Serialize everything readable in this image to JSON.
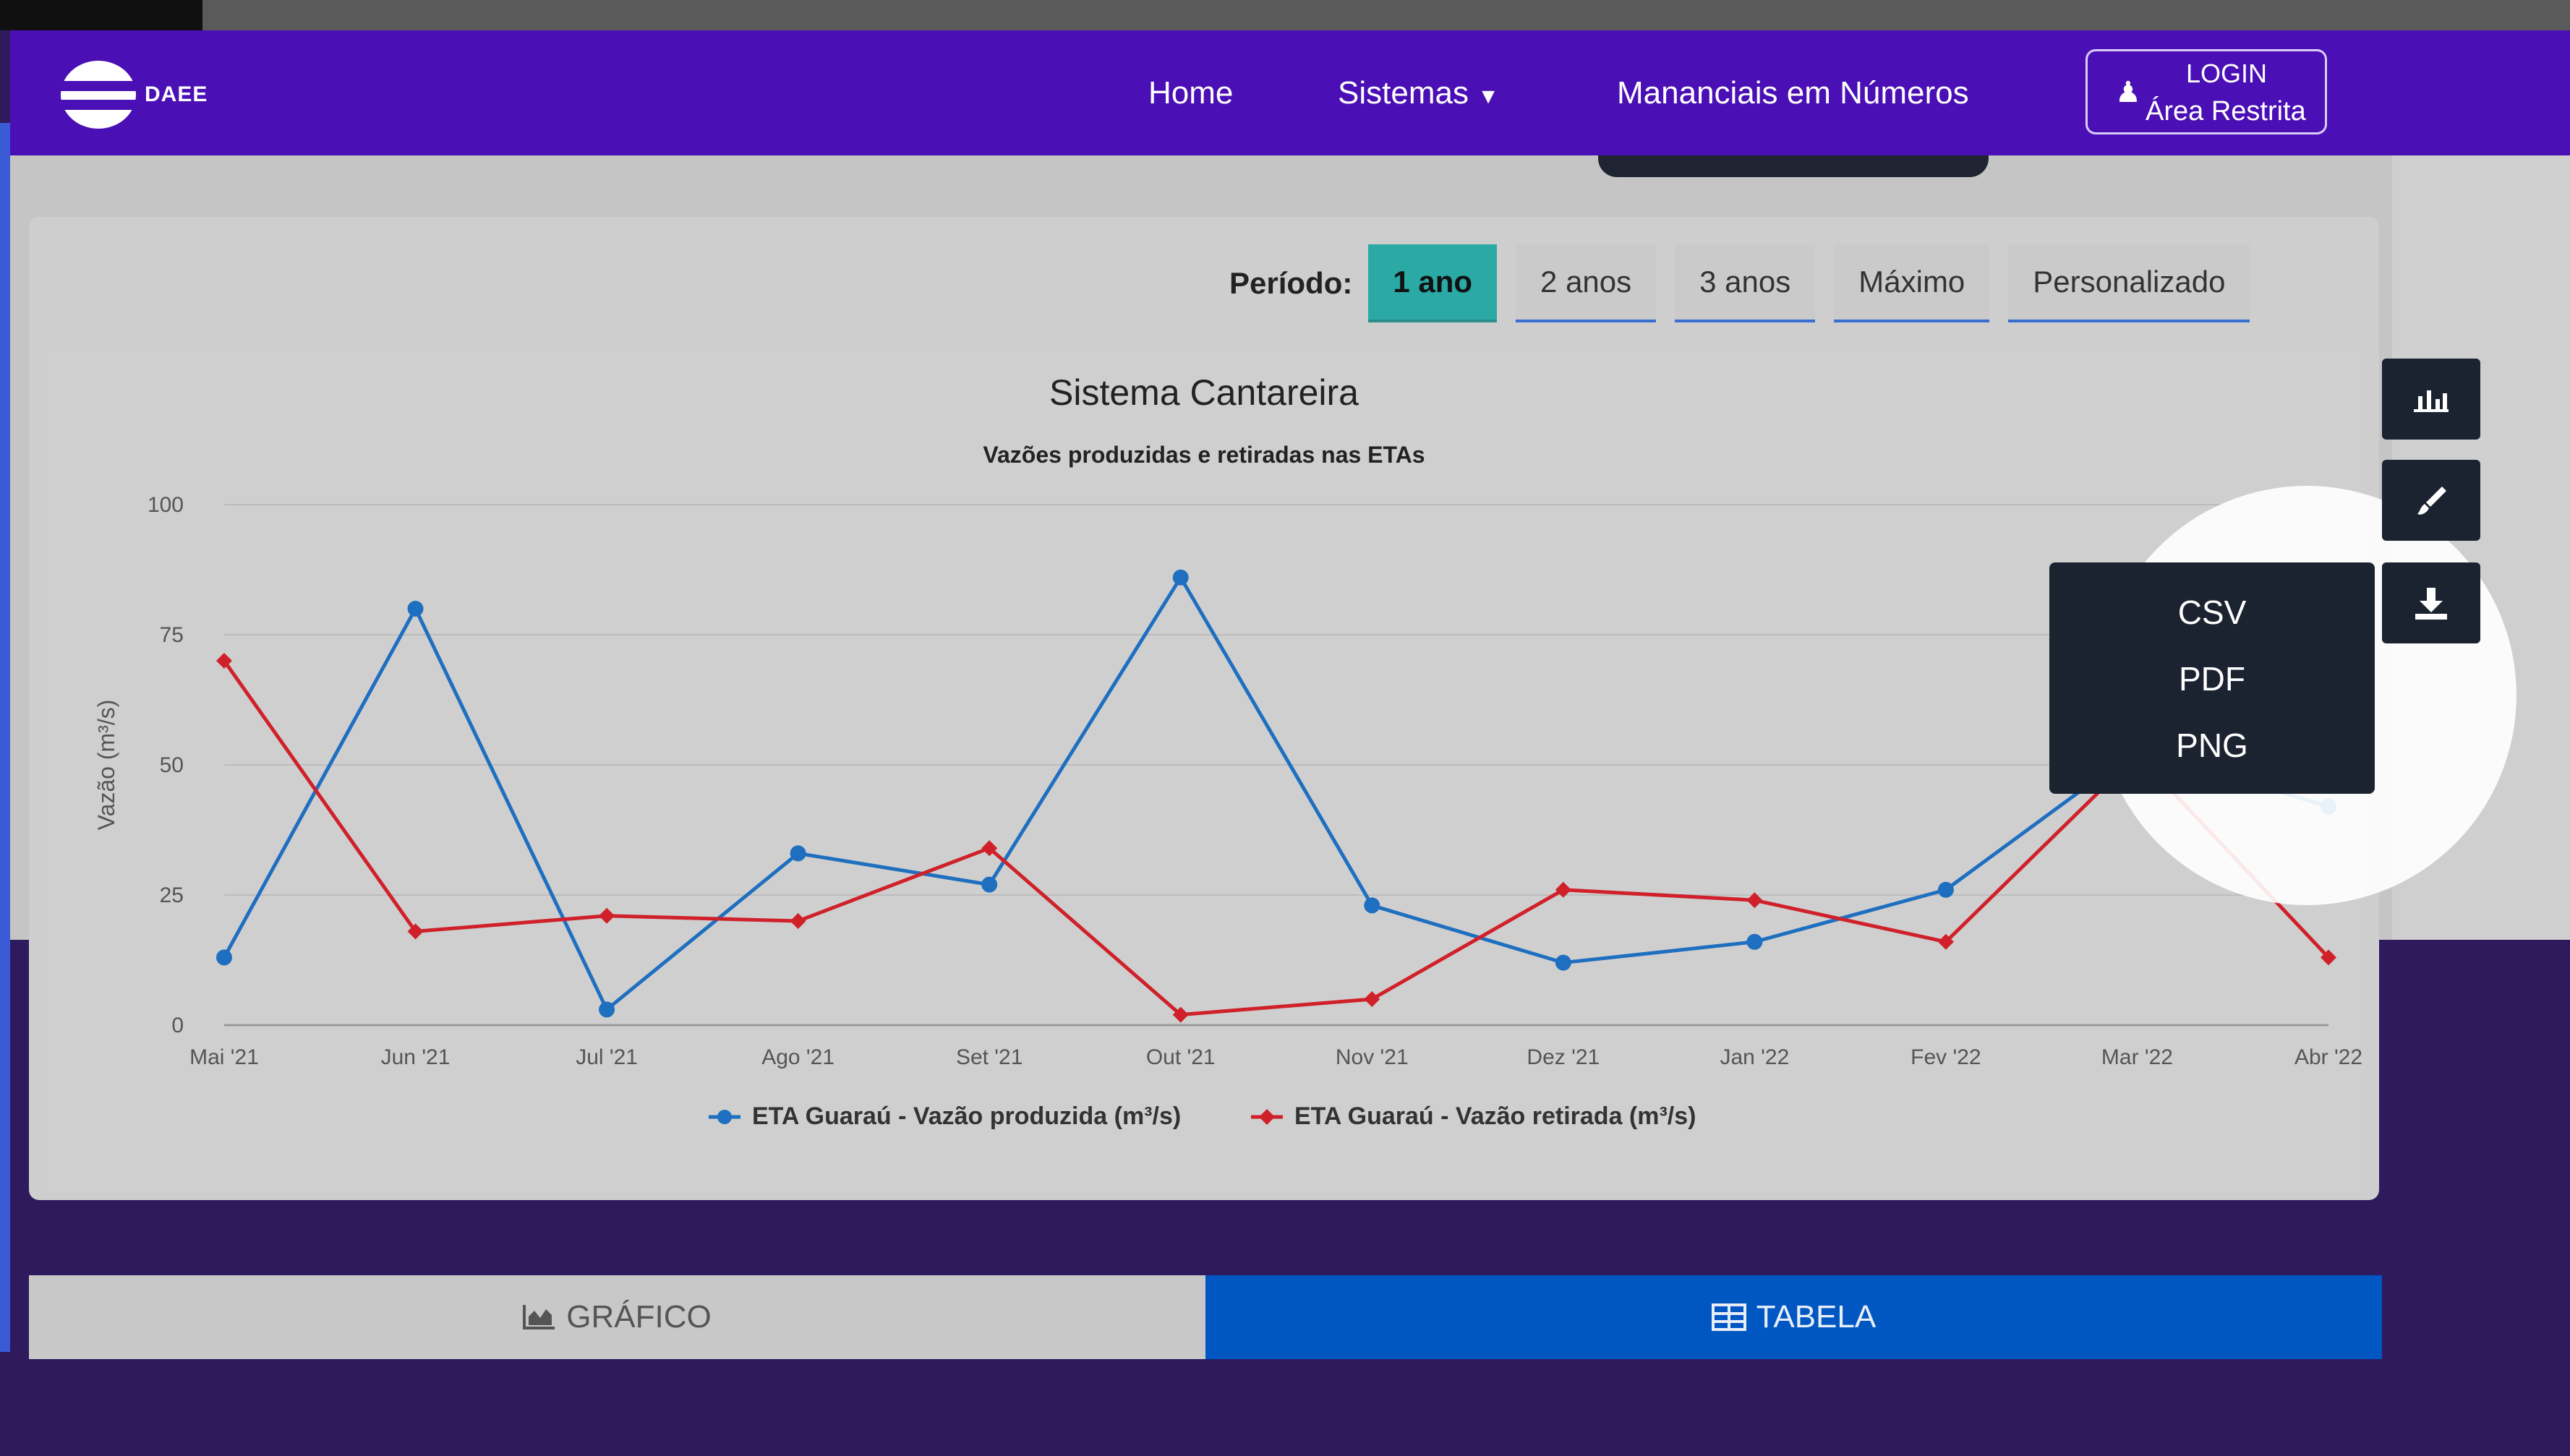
{
  "brand": {
    "name": "DAEE"
  },
  "nav": {
    "home": "Home",
    "sistemas": "Sistemas",
    "sistemas_icon": "caret-down-icon",
    "mananciais": "Mananciais em Números",
    "login_line1": "LOGIN",
    "login_line2": "Área Restrita",
    "login_icon": "user-icon"
  },
  "period": {
    "label": "Período:",
    "options": [
      "1 ano",
      "2 anos",
      "3 anos",
      "Máximo",
      "Personalizado"
    ],
    "selected": "1 ano"
  },
  "toolbar": {
    "chart_type_icon": "bar-chart-icon",
    "style_icon": "brush-icon",
    "download_icon": "download-icon"
  },
  "download_menu": [
    "CSV",
    "PDF",
    "PNG"
  ],
  "bottom_tabs": {
    "grafico": "GRÁFICO",
    "tabela": "TABELA",
    "grafico_icon": "area-chart-icon",
    "tabela_icon": "table-icon",
    "active": "TABELA"
  },
  "colors": {
    "navbar": "#4a0fb5",
    "series_produzida": "#1f6fc0",
    "series_retirada": "#d0212a",
    "active_period": "#2aa9a5",
    "active_tab": "#0057c2"
  },
  "chart_data": {
    "type": "line",
    "title": "Sistema Cantareira",
    "subtitle": "Vazões produzidas e retiradas nas ETAs",
    "ylabel": "Vazão (m³/s)",
    "xlabel": "",
    "ylim": [
      0,
      100
    ],
    "yticks": [
      0,
      25,
      50,
      75,
      100
    ],
    "grid": true,
    "legend_position": "bottom",
    "categories": [
      "Mai '21",
      "Jun '21",
      "Jul '21",
      "Ago '21",
      "Set '21",
      "Out '21",
      "Nov '21",
      "Dez '21",
      "Jan '22",
      "Fev '22",
      "Mar '22",
      "Abr '22"
    ],
    "series": [
      {
        "name": "ETA Guaraú - Vazão produzida (m³/s)",
        "color": "#1f6fc0",
        "marker": "circle",
        "values": [
          13,
          80,
          3,
          33,
          27,
          86,
          23,
          12,
          16,
          26,
          53,
          42
        ]
      },
      {
        "name": "ETA Guaraú - Vazão retirada (m³/s)",
        "color": "#d0212a",
        "marker": "diamond",
        "values": [
          70,
          18,
          21,
          20,
          34,
          2,
          5,
          26,
          24,
          16,
          52,
          13
        ]
      }
    ]
  }
}
